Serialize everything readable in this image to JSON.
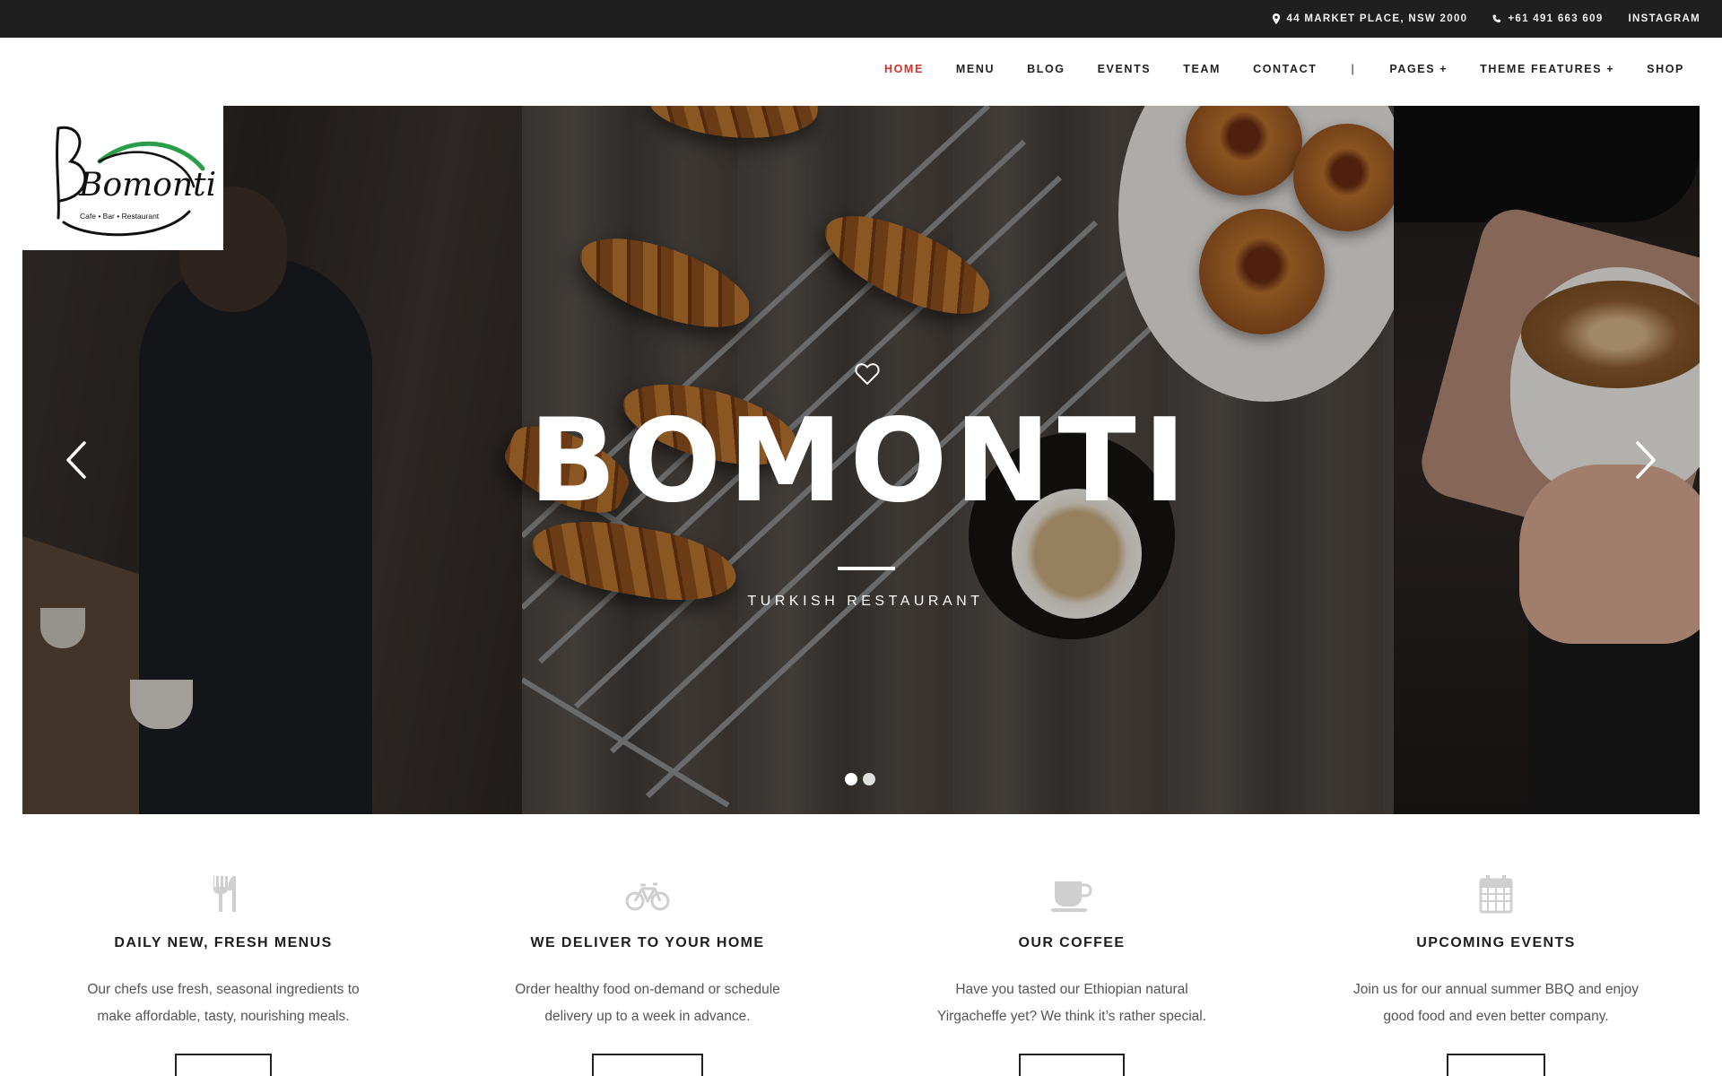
{
  "topbar": {
    "address": "44 MARKET PLACE, NSW 2000",
    "phone": "+61 491 663 609",
    "instagram": "INSTAGRAM"
  },
  "nav": {
    "items": [
      "HOME",
      "MENU",
      "BLOG",
      "EVENTS",
      "TEAM",
      "CONTACT",
      "|",
      "PAGES +",
      "THEME FEATURES +",
      "SHOP"
    ],
    "active": "HOME"
  },
  "logo": {
    "name": "Bomonti",
    "tagline": "Cafe • Bar • Restaurant"
  },
  "hero": {
    "title": "BOMONTI",
    "subtitle": "TURKISH RESTAURANT",
    "icon": "heart-icon",
    "slides_total": 2,
    "slide_active": 1
  },
  "features": [
    {
      "icon": "fork-knife-icon",
      "title": "DAILY NEW, FRESH MENUS",
      "line1": "Our chefs use fresh, seasonal ingredients to",
      "line2": "make affordable, tasty, nourishing meals."
    },
    {
      "icon": "bicycle-icon",
      "title": "WE DELIVER TO YOUR HOME",
      "line1": "Order healthy food on-demand or schedule",
      "line2": "delivery up to a week in advance."
    },
    {
      "icon": "coffee-cup-icon",
      "title": "OUR COFFEE",
      "line1": "Have you tasted our Ethiopian natural",
      "line2": "Yirgacheffe yet? We think it’s rather special."
    },
    {
      "icon": "calendar-icon",
      "title": "UPCOMING EVENTS",
      "line1": "Join us for our annual summer BBQ and enjoy",
      "line2": "good food and even better company."
    }
  ],
  "colors": {
    "accent": "#d0322b",
    "topbar_bg": "#1f1f1f",
    "text": "#222222"
  }
}
